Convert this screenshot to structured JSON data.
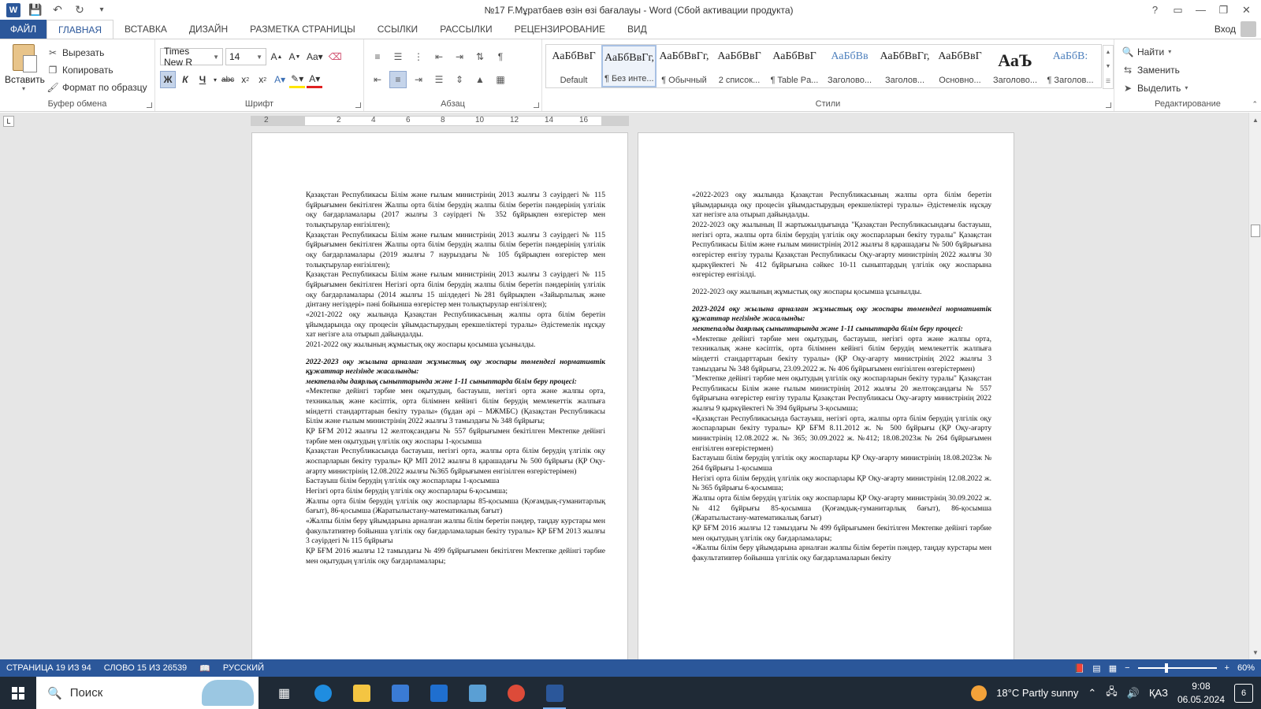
{
  "window": {
    "title": "№17 F.Мұратбаев өзін өзі бағалауы - Word (Сбой активации продукта)",
    "controls": {
      "help": "?",
      "ribbon_opts": "▭",
      "minimize": "—",
      "restore": "❐",
      "close": "✕"
    }
  },
  "tabs": {
    "file": "ФАЙЛ",
    "items": [
      "ГЛАВНАЯ",
      "ВСТАВКА",
      "ДИЗАЙН",
      "РАЗМЕТКА СТРАНИЦЫ",
      "ССЫЛКИ",
      "РАССЫЛКИ",
      "РЕЦЕНЗИРОВАНИЕ",
      "ВИД"
    ],
    "signin": "Вход"
  },
  "ribbon": {
    "clipboard": {
      "label": "Буфер обмена",
      "paste": "Вставить",
      "cut": "Вырезать",
      "copy": "Копировать",
      "format_painter": "Формат по образцу"
    },
    "font": {
      "label": "Шрифт",
      "font_name": "Times New R",
      "font_size": "14"
    },
    "paragraph": {
      "label": "Абзац"
    },
    "styles": {
      "label": "Стили",
      "items": [
        {
          "sample": "АаБбВвГ",
          "name": "Default"
        },
        {
          "sample": "АаБбВвГг,",
          "name": "¶ Без инте..."
        },
        {
          "sample": "АаБбВвГг,",
          "name": "¶ Обычный"
        },
        {
          "sample": "АаБбВвГ",
          "name": "2 список..."
        },
        {
          "sample": "АаБбВвГ",
          "name": "¶ Table Pa..."
        },
        {
          "sample": "АаБбВв",
          "name": "Заголово..."
        },
        {
          "sample": "АаБбВвГг,",
          "name": "Заголов..."
        },
        {
          "sample": "АаБбВвГ",
          "name": "Основно..."
        },
        {
          "sample": "АаЪ",
          "name": "Заголово..."
        },
        {
          "sample": "АаБбВ:",
          "name": "¶ Заголов..."
        }
      ]
    },
    "editing": {
      "label": "Редактирование",
      "find": "Найти",
      "replace": "Заменить",
      "select": "Выделить"
    }
  },
  "ruler": {
    "ticks": [
      "2",
      "2",
      "4",
      "6",
      "8",
      "10",
      "12",
      "14",
      "16"
    ]
  },
  "pages": {
    "left": [
      "Қазақстан Республикасы Білім және ғылым министрінің 2013 жылғы 3 сәуірдегі № 115 бұйрығымен бекітілген Жалпы орта білім берудің жалпы білім беретін пәндерінің үлгілік оқу бағдарламалары (2017 жылғы 3 сәуірдегі № 352 бұйрықпен өзгерістер мен толықтырулар енгізілген);",
      "Қазақстан Республикасы Білім және ғылым министрінің 2013 жылғы 3 сәуірдегі № 115 бұйрығымен бекітілген Жалпы орта білім берудің жалпы білім беретін пәндерінің үлгілік оқу бағдарламалары (2019 жылғы 7 наурыздағы № 105 бұйрықпен өзгерістер мен толықтырулар енгізілген);",
      "Қазақстан Республикасы Білім және ғылым министрінің 2013 жылғы 3 сәуірдегі № 115 бұйрығымен бекітілген Негізгі орта білім берудің жалпы білім беретін пәндерінің үлгілік оқу бағдарламалары (2014 жылғы 15 шілдедегі №281 бұйрықпен «Зайырлылық және дінтану негіздері» пәні бойынша өзгерістер мен толықтырулар енгізілген);",
      "«2021-2022 оқу жылында Қазақстан Республикасының жалпы орта білім беретін ұйымдарында оқу процесін ұйымдастырудың ерекшеліктері туралы» Әдістемелік нұсқау хат негізге ала отырып дайындалды.",
      "2021-2022 оқу жылының жұмыстық оқу жоспары қосымша ұсынылды.",
      "2022-2023 оқу жылына арналған жұмыстық оқу жоспары төмендегі нормативтік құжаттар негізінде жасалынды:",
      "мектепалды даярлық сыныптарында және 1-11 сыныптарда білім беру процесі:",
      "«Мектепке дейінгі тәрбие мен оқытудың, бастауыш, негізгі орта және жалпы орта, техникалық және кәсіптік, орта білімнен кейінгі білім берудің мемлекеттік жалпыға міндетті стандарттарын бекіту туралы» (бұдан әрі – МЖМБС) (Қазақстан Республикасы Білім және ғылым министрінің 2022 жылғы 3 тамыздағы № 348 бұйрығы;",
      "ҚР БҒМ 2012 жылғы 12 желтоқсандағы № 557 бұйрығымен бекітілген Мектепке дейінгі тәрбие мен оқытудың үлгілік оқу жоспары 1-қосымша",
      "Қазақстан Республикасында бастауыш, негізгі орта, жалпы орта білім берудің үлгілік оқу жоспарларын бекіту туралы» ҚР МП 2012 жылғы 8 қарашадағы № 500 бұйрығы (ҚР Оқу-ағарту министрінің 12.08.2022 жылғы №365 бұйрығымен енгізілген өзгерістерімен)",
      "Бастауыш білім берудің үлгілік оқу жоспарлары 1-қосымша",
      "Негізгі орта білім берудің үлгілік оқу жоспарлары 6-қосымша;",
      "Жалпы орта білім берудің үлгілік оқу жоспарлары 85-қосымша (Қоғамдық-гуманитарлық бағыт), 86-қосымша (Жаратылыстану-математикалық бағыт)",
      "«Жалпы білім беру ұйымдарына арналған жалпы білім беретін пәндер, таңдау курстары мен факультативтер бойынша үлгілік оқу бағдарламаларын бекіту туралы» ҚР БҒМ 2013 жылғы 3 сәуірдегі № 115 бұйрығы",
      "ҚР БҒМ 2016 жылғы 12 тамыздағы № 499 бұйрығымен бекітілген Мектепке дейінгі тәрбие мен оқытудың үлгілік оқу бағдарламалары;"
    ],
    "right": [
      "«2022-2023 оқу жылында Қазақстан Республикасының жалпы орта білім беретін ұйымдарында оқу процесін ұйымдастырудың ерекшеліктері туралы» Әдістемелік нұсқау хат негізге ала отырып дайындалды.",
      "2022-2023 оқу жылының II жартыжылдығында \"Қазақстан Республикасындағы бастауыш, негізгі орта, жалпы орта білім берудің үлгілік оқу жоспарларын бекіту туралы\" Қазақстан Республикасы Білім және ғылым министрінің 2012 жылғы 8 қарашадағы № 500 бұйрығына өзгерістер енгізу туралы Қазақстан Республикасы Оқу-ағарту министрінің 2022 жылғы 30 қыркүйектегі № 412 бұйрығына сәйкес 10-11 сыныптардың үлгілік оқу жоспарына өзгерістер енгізілді.",
      "2022-2023 оқу жылының жұмыстық оқу жоспары қосымша ұсынылды.",
      "2023-2024 оқу жылына арналған жұмыстық оқу жоспары төмендегі нормативтік құжаттар негізінде жасалынды:",
      "мектепалды даярлық сыныптарында және 1-11 сыныптарда білім беру процесі:",
      "«Мектепке дейінгі тәрбие мен оқытудың, бастауыш, негізгі орта және жалпы орта, техникалық және кәсіптік, орта білімнен кейінгі білім берудің мемлекеттік жалпыға міндетті стандарттарын бекіту туралы» (ҚР Оқу-ағарту министрінің 2022 жылғы 3 тамыздағы № 348 бұйрығы, 23.09.2022 ж. № 406 бұйрығымен енгізілген өзгерістермен)",
      "\"Мектепке дейінгі тәрбие мен оқытудың үлгілік оқу жоспарларын бекіту туралы\" Қазақстан Республикасы Білім және ғылым министрінің 2012 жылғы 20 желтоқсандағы № 557 бұйрығына өзгерістер енгізу туралы Қазақстан Республикасы Оқу-ағарту министрінің 2022 жылғы 9 қыркүйектегі № 394 бұйрығы 3-қосымша;",
      "«Қазақстан Республикасында бастауыш, негізгі орта, жалпы орта білім берудің үлгілік оқу жоспарларын бекіту туралы» ҚР БҒМ 8.11.2012 ж. № 500 бұйрығы (ҚР Оқу-ағарту министрінің 12.08.2022 ж. № 365; 30.09.2022 ж. №412; 18.08.2023ж № 264 бұйрығымен енгізілген өзгерістермен)",
      "Бастауыш білім берудің үлгілік оқу жоспарлары ҚР Оқу-ағарту министрінің 18.08.2023ж № 264 бұйрығы 1-қосымша",
      "Негізгі орта білім берудің үлгілік оқу жоспарлары ҚР Оқу-ағарту министрінің 12.08.2022 ж. № 365 бұйрығы 6-қосымша;",
      "Жалпы орта білім берудің үлгілік оқу жоспарлары ҚР Оқу-ағарту министрінің 30.09.2022 ж. №412 бұйрығы 85-қосымша (Қоғамдық-гуманитарлық бағыт), 86-қосымша (Жаратылыстану-математикалық бағыт)",
      "ҚР БҒМ 2016 жылғы 12 тамыздағы № 499 бұйрығымен бекітілген Мектепке дейінгі тәрбие мен оқытудың үлгілік оқу бағдарламалары;",
      "«Жалпы білім беру ұйымдарына арналған жалпы білім беретін пәндер, таңдау курстары мен факультативтер бойынша үлгілік оқу бағдарламаларын бекіту"
    ]
  },
  "status": {
    "page": "СТРАНИЦА 19 ИЗ 94",
    "words": "СЛОВО 15 ИЗ 26539",
    "language": "РУССКИЙ",
    "zoom": "60%",
    "zoom_minus": "−",
    "zoom_plus": "+"
  },
  "taskbar": {
    "search": "Поиск",
    "weather": "18°C Partly sunny",
    "lang": "ҚАЗ",
    "time": "9:08",
    "date": "06.05.2024",
    "notifications": "6"
  }
}
